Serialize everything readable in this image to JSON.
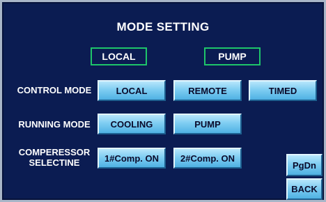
{
  "title": "MODE SETTING",
  "status": {
    "location": "LOCAL",
    "mode": "PUMP",
    "border_color": "#1ec56a"
  },
  "rows": {
    "control_mode": {
      "label": "CONTROL MODE",
      "buttons": [
        "LOCAL",
        "REMOTE",
        "TIMED"
      ]
    },
    "running_mode": {
      "label": "RUNNING MODE",
      "buttons": [
        "COOLING",
        "PUMP"
      ]
    },
    "compressor": {
      "label_line1": "COMPERESSOR",
      "label_line2": "SELECTINE",
      "buttons": [
        "1#Comp. ON",
        "2#Comp. ON"
      ]
    }
  },
  "nav": {
    "pgdn": "PgDn",
    "back": "BACK"
  },
  "colors": {
    "background": "#0b1c52",
    "button_face": "#7fcdf2",
    "text": "#ffffff"
  }
}
